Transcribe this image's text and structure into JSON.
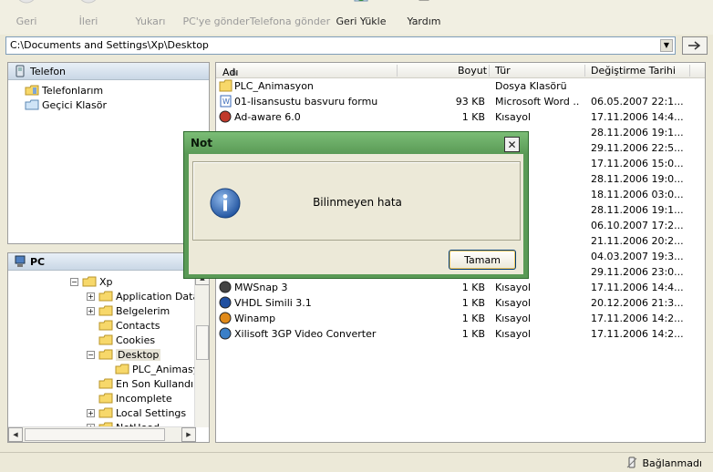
{
  "toolbar": {
    "buttons": [
      {
        "label": "Geri",
        "icon": "back-arrow-icon",
        "enabled": false
      },
      {
        "label": "İleri",
        "icon": "forward-arrow-icon",
        "enabled": false
      },
      {
        "label": "Yukarı",
        "icon": "up-folder-icon",
        "enabled": false
      },
      {
        "label": "PC'ye gönder",
        "icon": "send-to-pc-icon",
        "enabled": false
      },
      {
        "label": "Telefona gönder",
        "icon": "send-to-phone-icon",
        "enabled": false
      },
      {
        "label": "Geri Yükle",
        "icon": "restore-icon",
        "enabled": true
      },
      {
        "label": "Yardım",
        "icon": "help-icon",
        "enabled": true
      }
    ]
  },
  "address": {
    "path": "C:\\Documents and Settings\\Xp\\Desktop"
  },
  "phone_panel": {
    "title": "Telefon",
    "items": [
      {
        "label": "Telefonlarım",
        "icon": "phone-folder-icon"
      },
      {
        "label": "Geçici Klasör",
        "icon": "folder-icon"
      }
    ]
  },
  "pc_panel": {
    "title": "PC",
    "items": [
      {
        "label": "Xp",
        "expander": "minus"
      },
      {
        "label": "Application Data",
        "expander": "plus"
      },
      {
        "label": "Belgelerim",
        "expander": "plus"
      },
      {
        "label": "Contacts",
        "expander": ""
      },
      {
        "label": "Cookies",
        "expander": ""
      },
      {
        "label": "Desktop",
        "expander": "minus"
      },
      {
        "label": "PLC_Animasy",
        "expander": ""
      },
      {
        "label": "En Son Kullandıkl",
        "expander": ""
      },
      {
        "label": "Incomplete",
        "expander": ""
      },
      {
        "label": "Local Settings",
        "expander": "plus"
      },
      {
        "label": "NetHood",
        "expander": "plus"
      }
    ]
  },
  "filelist": {
    "columns": {
      "name": "Adı",
      "size": "Boyut",
      "type": "Tür",
      "modified": "Değiştirme Tarihi"
    },
    "rows": [
      {
        "name": "PLC_Animasyon",
        "size": "",
        "type": "Dosya Klasörü",
        "modified": ""
      },
      {
        "name": "01-lisansustu basvuru formu",
        "size": "93 KB",
        "type": "Microsoft Word ...",
        "modified": "06.05.2007 22:1..."
      },
      {
        "name": "Ad-aware 6.0",
        "size": "1 KB",
        "type": "Kısayol",
        "modified": "17.11.2006 14:4..."
      },
      {
        "name": "",
        "size": "",
        "type": "",
        "modified": "28.11.2006 19:1..."
      },
      {
        "name": "",
        "size": "",
        "type": "",
        "modified": "29.11.2006 22:5..."
      },
      {
        "name": "",
        "size": "",
        "type": "",
        "modified": "17.11.2006 15:0..."
      },
      {
        "name": "",
        "size": "",
        "type": "",
        "modified": "28.11.2006 19:0..."
      },
      {
        "name": "",
        "size": "",
        "type": "",
        "modified": "18.11.2006 03:0..."
      },
      {
        "name": "",
        "size": "",
        "type": "",
        "modified": "28.11.2006 19:1..."
      },
      {
        "name": "",
        "size": "",
        "type": "",
        "modified": "06.10.2007 17:2..."
      },
      {
        "name": "",
        "size": "",
        "type": "",
        "modified": "21.11.2006 20:2..."
      },
      {
        "name": "",
        "size": "",
        "type": "",
        "modified": "04.03.2007 19:3..."
      },
      {
        "name": "",
        "size": "",
        "type": "",
        "modified": "29.11.2006 23:0..."
      },
      {
        "name": "MWSnap 3",
        "size": "1 KB",
        "type": "Kısayol",
        "modified": "17.11.2006 14:4..."
      },
      {
        "name": "VHDL Simili 3.1",
        "size": "1 KB",
        "type": "Kısayol",
        "modified": "20.12.2006 21:3..."
      },
      {
        "name": "Winamp",
        "size": "1 KB",
        "type": "Kısayol",
        "modified": "17.11.2006 14:2..."
      },
      {
        "name": "Xilisoft 3GP Video Converter",
        "size": "1 KB",
        "type": "Kısayol",
        "modified": "17.11.2006 14:2..."
      }
    ]
  },
  "status": {
    "connection": "Bağlanmadı"
  },
  "dialog": {
    "title": "Not",
    "message": "Bilinmeyen hata",
    "ok_label": "Tamam",
    "icon": "info-icon"
  }
}
